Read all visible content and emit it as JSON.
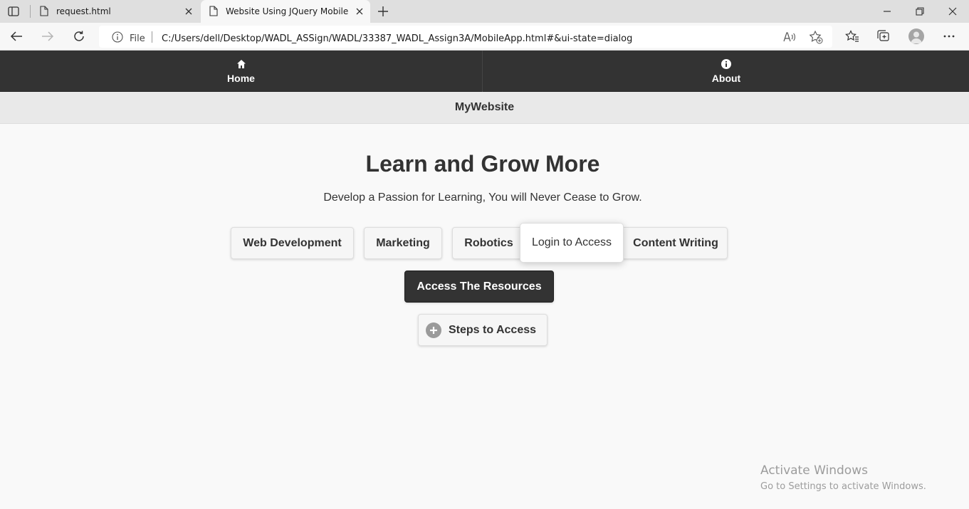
{
  "browser": {
    "tabs": [
      {
        "title": "request.html"
      },
      {
        "title": "Website Using JQuery Mobile"
      }
    ],
    "address": {
      "file_label": "File",
      "url": "C:/Users/dell/Desktop/WADL_ASSign/WADL/33387_WADL_Assign3A/MobileApp.html#&ui-state=dialog"
    }
  },
  "page": {
    "navbar": {
      "items": [
        {
          "label": "Home",
          "icon": "home-icon"
        },
        {
          "label": "About",
          "icon": "info-icon"
        }
      ]
    },
    "header": {
      "title": "MyWebsite"
    },
    "hero": {
      "title": "Learn and Grow More",
      "subtitle": "Develop a Passion for Learning, You will Never Cease to Grow."
    },
    "buttons": {
      "web_development": "Web Development",
      "marketing": "Marketing",
      "robotics": "Robotics",
      "content_writing": "Content Writing",
      "access": "Access The Resources",
      "steps": "Steps to Access"
    },
    "popup": {
      "text": "Login to Access"
    }
  },
  "watermark": {
    "title": "Activate Windows",
    "subtitle": "Go to Settings to activate Windows."
  },
  "colors": {
    "navbar_bg": "#333333",
    "header_bg": "#e9e9e9",
    "page_bg": "#f9f9f9",
    "button_bg": "#f6f6f6",
    "primary_button_bg": "#333333"
  }
}
